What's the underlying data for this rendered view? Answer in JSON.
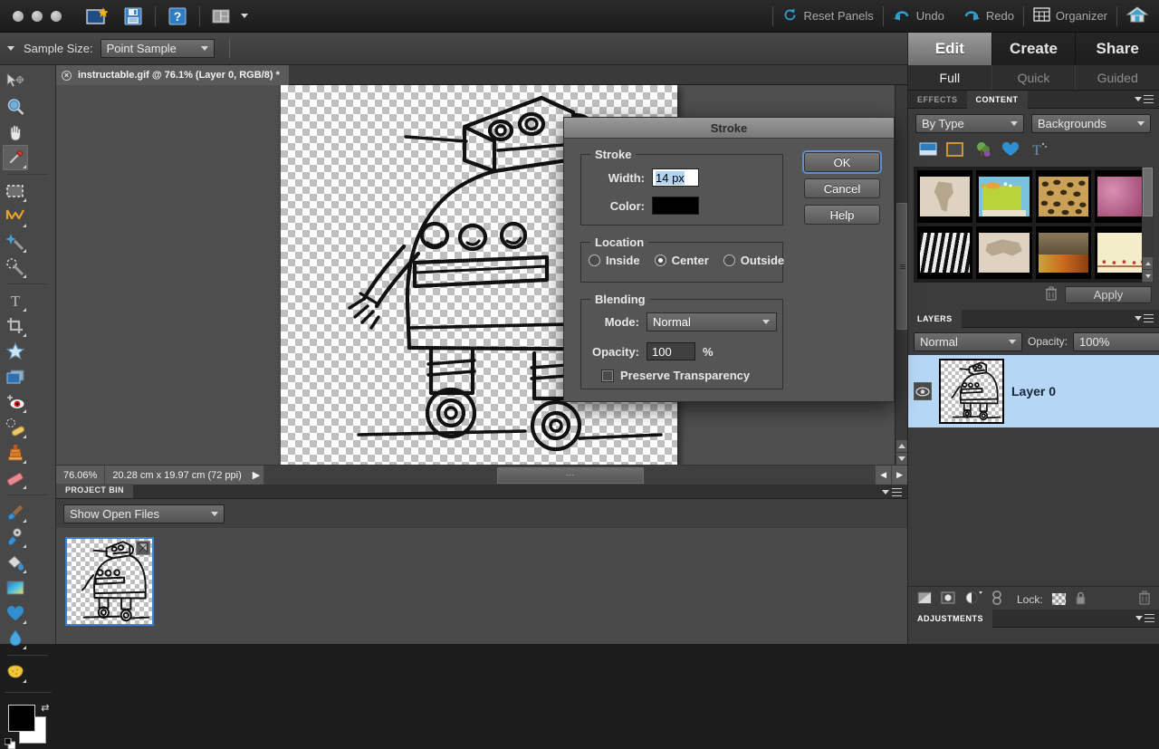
{
  "menubar": {
    "icons": [
      {
        "name": "new-file-icon",
        "label": "New"
      },
      {
        "name": "save-icon",
        "label": "Save"
      },
      {
        "name": "help-icon",
        "label": "Help"
      },
      {
        "name": "layout-icon",
        "label": "Layout"
      }
    ],
    "right_items": [
      {
        "name": "reset-panels-button",
        "label": "Reset Panels",
        "icon": "reset-icon"
      },
      {
        "name": "undo-button",
        "label": "Undo",
        "icon": "undo-arrow-icon"
      },
      {
        "name": "redo-button",
        "label": "Redo",
        "icon": "redo-arrow-icon"
      },
      {
        "name": "organizer-button",
        "label": "Organizer",
        "icon": "grid-icon"
      },
      {
        "name": "home-button",
        "label": "",
        "icon": "home-icon"
      }
    ]
  },
  "options_bar": {
    "label": "Sample Size:",
    "sample_size_value": "Point Sample"
  },
  "toolbox": {
    "tools": [
      {
        "name": "move-tool",
        "glyph": "move"
      },
      {
        "name": "zoom-tool",
        "glyph": "zoom"
      },
      {
        "name": "hand-tool",
        "glyph": "hand"
      },
      {
        "name": "eyedropper-tool",
        "glyph": "eyedropper",
        "selected": true
      },
      {
        "name": "marquee-tool",
        "glyph": "marquee"
      },
      {
        "name": "lasso-tool",
        "glyph": "lasso"
      },
      {
        "name": "magic-wand-tool",
        "glyph": "wand"
      },
      {
        "name": "quick-selection-tool",
        "glyph": "quickselect"
      },
      {
        "name": "type-tool",
        "glyph": "type"
      },
      {
        "name": "crop-tool",
        "glyph": "crop"
      },
      {
        "name": "cookie-cutter-tool",
        "glyph": "star"
      },
      {
        "name": "straighten-tool",
        "glyph": "rect"
      },
      {
        "name": "red-eye-tool",
        "glyph": "eye"
      },
      {
        "name": "healing-brush-tool",
        "glyph": "bandaid"
      },
      {
        "name": "clone-stamp-tool",
        "glyph": "stamp"
      },
      {
        "name": "eraser-tool",
        "glyph": "eraser"
      },
      {
        "name": "brush-tool",
        "glyph": "brush"
      },
      {
        "name": "smart-brush-tool",
        "glyph": "gearbrush"
      },
      {
        "name": "paint-bucket-tool",
        "glyph": "bucket"
      },
      {
        "name": "gradient-tool",
        "glyph": "gradient"
      },
      {
        "name": "shape-tool",
        "glyph": "heart"
      },
      {
        "name": "blur-tool",
        "glyph": "drop"
      },
      {
        "name": "sponge-tool",
        "glyph": "sponge"
      }
    ],
    "foreground_color": "#000000",
    "background_color": "#ffffff"
  },
  "document": {
    "tab_title": "instructable.gif @ 76.1% (Layer 0, RGB/8) *",
    "close_glyph": "×"
  },
  "status_bar": {
    "zoom": "76.06%",
    "dimensions": "20.28 cm x 19.97 cm (72 ppi)",
    "grip": "⋯",
    "left_arrow": "◀",
    "right_arrow": "▶",
    "flyout_arrow": "▶"
  },
  "project_bin": {
    "tab_label": "PROJECT BIN",
    "filter_value": "Show Open Files"
  },
  "right_panel": {
    "mode_tabs": [
      {
        "name": "tab-edit",
        "label": "Edit",
        "active": true
      },
      {
        "name": "tab-create",
        "label": "Create",
        "active": false
      },
      {
        "name": "tab-share",
        "label": "Share",
        "active": false
      }
    ],
    "sub_tabs": [
      {
        "name": "subtab-full",
        "label": "Full",
        "active": true
      },
      {
        "name": "subtab-quick",
        "label": "Quick",
        "active": false
      },
      {
        "name": "subtab-guided",
        "label": "Guided",
        "active": false
      }
    ],
    "content_panel": {
      "tabs": [
        {
          "name": "panel-tab-effects",
          "label": "EFFECTS",
          "active": false
        },
        {
          "name": "panel-tab-content",
          "label": "CONTENT",
          "active": true
        }
      ],
      "filter_by": "By Type",
      "filter_category": "Backgrounds",
      "category_icons": [
        {
          "name": "backgrounds-icon"
        },
        {
          "name": "frames-icon"
        },
        {
          "name": "graphics-icon"
        },
        {
          "name": "shapes-icon"
        },
        {
          "name": "text-icon"
        }
      ],
      "thumbnails": [
        {
          "name": "thumb-africa-map",
          "c1": "#e0d6c4",
          "c2": "#b9ab92"
        },
        {
          "name": "thumb-fish-scene",
          "c1": "#7fc7e0",
          "c2": "#b9d43b"
        },
        {
          "name": "thumb-leopard-print",
          "c1": "#c9a257",
          "c2": "#3a2a12"
        },
        {
          "name": "thumb-pink-texture",
          "c1": "#c87ca0",
          "c2": "#9b4f72"
        },
        {
          "name": "thumb-zebra-stripes",
          "c1": "#1a1a1a",
          "c2": "#e8e8e8"
        },
        {
          "name": "thumb-asia-map",
          "c1": "#ddd2bf",
          "c2": "#b6a78e"
        },
        {
          "name": "thumb-autumn-still-life",
          "c1": "#8c7a5a",
          "c2": "#c9691f"
        },
        {
          "name": "thumb-cream-berries",
          "c1": "#f3eec9",
          "c2": "#c23a3a"
        }
      ],
      "apply_label": "Apply",
      "trash_icon": "trash-icon"
    },
    "layers_panel": {
      "tab_label": "LAYERS",
      "blend_mode": "Normal",
      "opacity_label": "Opacity:",
      "opacity_value": "100%",
      "layers": [
        {
          "name": "layer-row-layer0",
          "label": "Layer 0",
          "visible": true
        }
      ],
      "lock_label": "Lock:",
      "bottom_icons": [
        {
          "name": "new-layer-icon"
        },
        {
          "name": "layer-mask-icon"
        },
        {
          "name": "adjustment-layer-icon"
        },
        {
          "name": "link-layers-icon"
        },
        {
          "name": "lock-transparency-icon"
        },
        {
          "name": "lock-all-icon"
        },
        {
          "name": "delete-layer-icon"
        }
      ]
    },
    "adjustments_panel": {
      "tab_label": "ADJUSTMENTS"
    }
  },
  "dialog": {
    "title": "Stroke",
    "groups": {
      "stroke": {
        "title": "Stroke",
        "width_label": "Width:",
        "width_value": "14 px",
        "color_label": "Color:",
        "color_value": "#000000"
      },
      "location": {
        "title": "Location",
        "options": [
          {
            "name": "radio-inside",
            "label": "Inside",
            "selected": false
          },
          {
            "name": "radio-center",
            "label": "Center",
            "selected": true
          },
          {
            "name": "radio-outside",
            "label": "Outside",
            "selected": false
          }
        ]
      },
      "blending": {
        "title": "Blending",
        "mode_label": "Mode:",
        "mode_value": "Normal",
        "opacity_label": "Opacity:",
        "opacity_value": "100",
        "percent_sign": "%",
        "preserve_label": "Preserve Transparency",
        "preserve_checked": false
      }
    },
    "buttons": [
      {
        "name": "ok-button",
        "label": "OK",
        "focused": true
      },
      {
        "name": "cancel-button",
        "label": "Cancel",
        "focused": false
      },
      {
        "name": "help-button",
        "label": "Help",
        "focused": false
      }
    ]
  },
  "colors": {
    "accent_blue": "#2f9fd0",
    "selection_blue": "#b6d6f5",
    "focus_ring": "#5b8fd6",
    "panel_bg": "#3c3c3c"
  }
}
